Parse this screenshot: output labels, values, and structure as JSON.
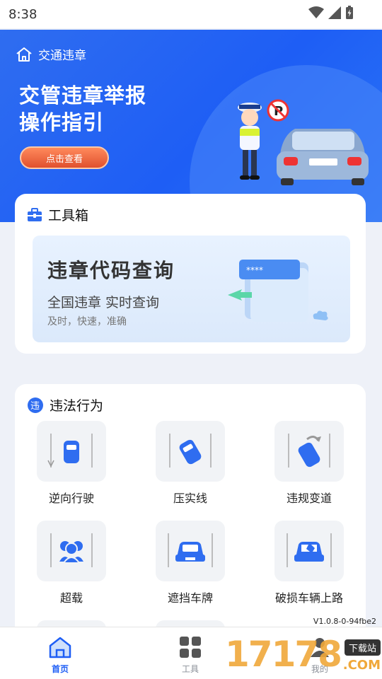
{
  "status_bar": {
    "time": "8:38"
  },
  "hero": {
    "home_label": "交通违章",
    "title_line1": "交管违章举报",
    "title_line2": "操作指引",
    "button_label": "点击查看"
  },
  "toolbox": {
    "title": "工具箱",
    "banner": {
      "title": "违章代码查询",
      "subtitle": "全国违章 实时查询",
      "note": "及时，快速，准确",
      "card_text": "****"
    }
  },
  "violations": {
    "title": "违法行为",
    "badge_char": "违",
    "items": [
      {
        "label": "逆向行驶",
        "icon": "car-wrong-way-icon"
      },
      {
        "label": "压实线",
        "icon": "car-crossing-line-icon"
      },
      {
        "label": "违规变道",
        "icon": "car-lane-change-icon"
      },
      {
        "label": "超载",
        "icon": "overload-people-icon"
      },
      {
        "label": "遮挡车牌",
        "icon": "plate-covered-icon"
      },
      {
        "label": "破损车辆上路",
        "icon": "damaged-car-icon"
      }
    ]
  },
  "version": "V1.0.8-0-94fbe2",
  "tabbar": {
    "tabs": [
      {
        "label": "首页",
        "active": true
      },
      {
        "label": "工具",
        "active": false
      },
      {
        "label": "我的",
        "active": false
      }
    ]
  },
  "watermark": {
    "text": "17178",
    "badge": "下载站",
    "suffix": ".COM"
  },
  "colors": {
    "primary": "#1e5ef5",
    "accent": "#e0502e",
    "tab_active": "#1e5ef5",
    "tab_inactive": "#8a8f98"
  }
}
